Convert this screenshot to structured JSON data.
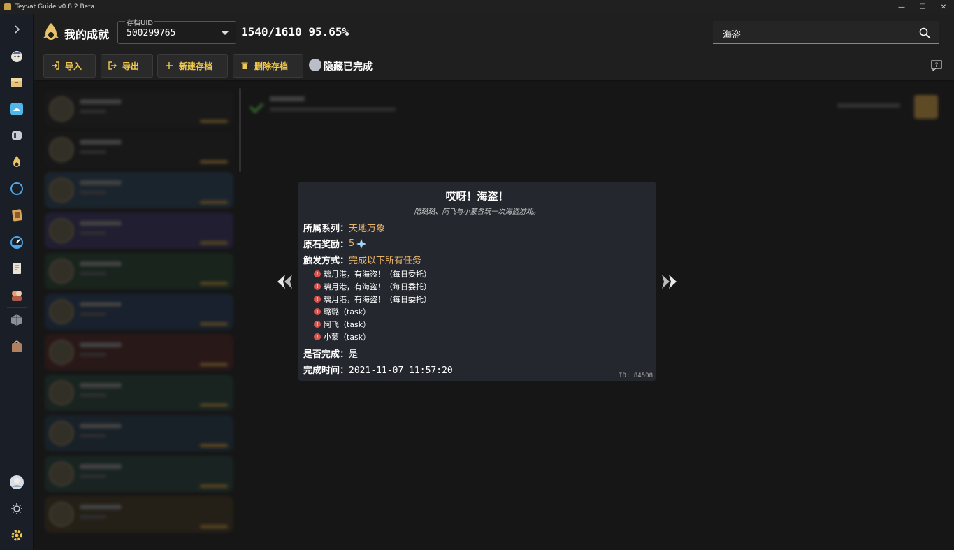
{
  "window": {
    "title": "Teyvat Guide v0.8.2 Beta",
    "controls": [
      "—",
      "☐",
      "✕"
    ]
  },
  "sidebar": {
    "items": [
      {
        "icon": "chevron-right-icon"
      },
      {
        "icon": "paimon-icon"
      },
      {
        "icon": "inventory-icon"
      },
      {
        "icon": "wish-icon"
      },
      {
        "icon": "controller-icon"
      },
      {
        "icon": "achievement-icon"
      },
      {
        "icon": "compass-icon"
      },
      {
        "icon": "card-icon"
      },
      {
        "icon": "gauge-icon"
      },
      {
        "icon": "notebook-icon"
      },
      {
        "icon": "characters-icon"
      },
      {
        "icon": "box-icon"
      },
      {
        "icon": "bag-icon"
      }
    ],
    "bottom": [
      {
        "icon": "avatar-icon"
      },
      {
        "icon": "theme-icon"
      },
      {
        "icon": "settings-icon"
      }
    ]
  },
  "header": {
    "title": "我的成就",
    "uid_label": "存档UID",
    "uid_value": "500299765",
    "progress": "1540/1610 95.65%",
    "search_value": "海盗",
    "buttons": {
      "import": "导入",
      "export": "导出",
      "new_archive": "新建存档",
      "delete_archive": "删除存档"
    },
    "toggle_label": "隐藏已完成"
  },
  "dialog": {
    "title": "哎呀！海盗！",
    "subtitle": "陪璐璐、阿飞与小蒙各玩一次海盗游戏。",
    "series_label": "所属系列：",
    "series_value": "天地万象",
    "reward_label": "原石奖励：",
    "reward_value": "5",
    "trigger_label": "触发方式：",
    "trigger_value": "完成以下所有任务",
    "tasks": [
      "璃月港，有海盗！（每日委托）",
      "璃月港，有海盗！（每日委托）",
      "璃月港，有海盗！（每日委托）",
      "璐璐（task）",
      "阿飞（task）",
      "小蒙（task）"
    ],
    "done_label": "是否完成：",
    "done_value": "是",
    "time_label": "完成时间：",
    "time_value": "2021-11-07 11:57:20",
    "id": "ID: 84508"
  },
  "colors": {
    "accent": "#f0c850",
    "value": "#e8b56a",
    "task_dot": "#d9534f",
    "primogem": "#9fd8f0"
  }
}
